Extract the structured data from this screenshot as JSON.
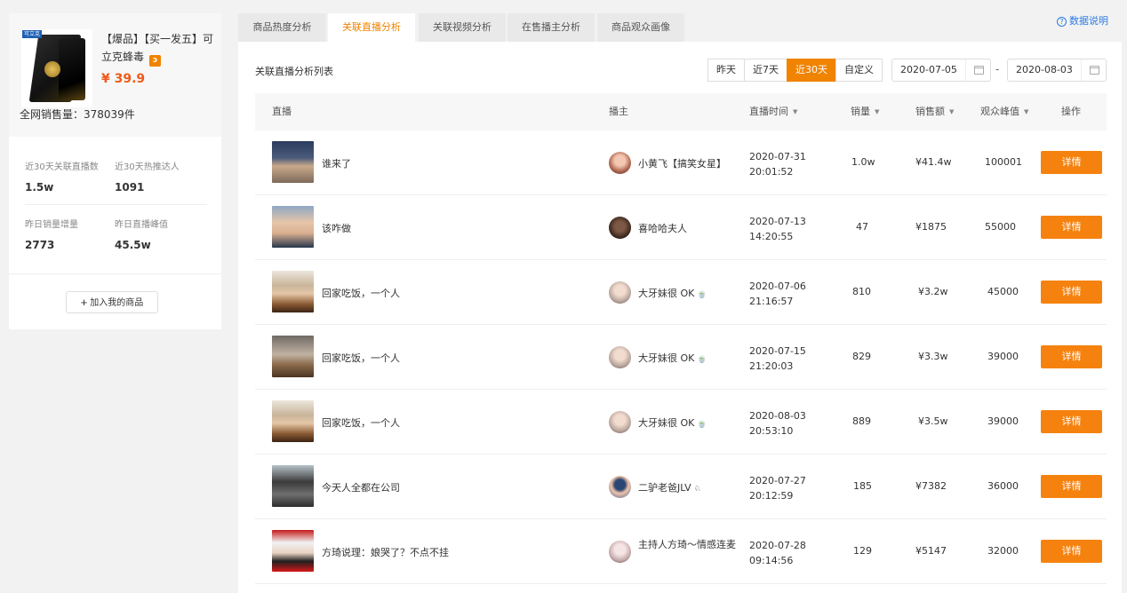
{
  "product": {
    "title": "【爆品】【买一发五】可立克蜂毒",
    "badge_icon": "rss-icon",
    "price": "¥ 39.9",
    "total_sales": "全网销售量：378039件",
    "image_tag": "可立克"
  },
  "stats": [
    {
      "label": "近30天关联直播数",
      "value": "1.5w"
    },
    {
      "label": "近30天热推达人",
      "value": "1091"
    },
    {
      "label": "昨日销量增量",
      "value": "2773"
    },
    {
      "label": "昨日直播峰值",
      "value": "45.5w"
    }
  ],
  "add_button": "加入我的商品",
  "tabs": [
    {
      "label": "商品热度分析",
      "active": false
    },
    {
      "label": "关联直播分析",
      "active": true
    },
    {
      "label": "关联视频分析",
      "active": false
    },
    {
      "label": "在售播主分析",
      "active": false
    },
    {
      "label": "商品观众画像",
      "active": false
    }
  ],
  "help_link": "数据说明",
  "list_title": "关联直播分析列表",
  "range_buttons": [
    {
      "label": "昨天",
      "active": false
    },
    {
      "label": "近7天",
      "active": false
    },
    {
      "label": "近30天",
      "active": true
    },
    {
      "label": "自定义",
      "active": false
    }
  ],
  "date_start": "2020-07-05",
  "date_end": "2020-08-03",
  "date_sep": "-",
  "columns": {
    "live": "直播",
    "anchor": "播主",
    "time": "直播时间",
    "sales": "销量",
    "amount": "销售额",
    "peak": "观众峰值",
    "action": "操作"
  },
  "sort_arrow": "▼",
  "rows": [
    {
      "title": "谁来了",
      "anchor": "小黄飞【搞笑女星】",
      "anchor_icon": "",
      "date": "2020-07-31",
      "clock": "20:01:52",
      "sales": "1.0w",
      "amount": "¥41.4w",
      "peak": "100001",
      "action": "详情"
    },
    {
      "title": "该咋做",
      "anchor": "喜哈哈夫人",
      "anchor_icon": "",
      "date": "2020-07-13",
      "clock": "14:20:55",
      "sales": "47",
      "amount": "¥1875",
      "peak": "55000",
      "action": "详情"
    },
    {
      "title": "回家吃饭，一个人",
      "anchor": "大牙妹很 OK",
      "anchor_icon": "🍵",
      "date": "2020-07-06",
      "clock": "21:16:57",
      "sales": "810",
      "amount": "¥3.2w",
      "peak": "45000",
      "action": "详情"
    },
    {
      "title": "回家吃饭，一个人",
      "anchor": "大牙妹很 OK",
      "anchor_icon": "🍵",
      "date": "2020-07-15",
      "clock": "21:20:03",
      "sales": "829",
      "amount": "¥3.3w",
      "peak": "39000",
      "action": "详情"
    },
    {
      "title": "回家吃饭，一个人",
      "anchor": "大牙妹很 OK",
      "anchor_icon": "🍵",
      "date": "2020-08-03",
      "clock": "20:53:10",
      "sales": "889",
      "amount": "¥3.5w",
      "peak": "39000",
      "action": "详情"
    },
    {
      "title": "今天人全都在公司",
      "anchor": "二驴老爸JLV",
      "anchor_icon": "♘",
      "date": "2020-07-27",
      "clock": "20:12:59",
      "sales": "185",
      "amount": "¥7382",
      "peak": "36000",
      "action": "详情"
    },
    {
      "title": "方琦说理：娘哭了？不点不挂",
      "anchor": "主持人方琦～情感连麦",
      "anchor_icon": "",
      "date": "2020-07-28",
      "clock": "09:14:56",
      "sales": "129",
      "amount": "¥5147",
      "peak": "32000",
      "action": "详情"
    }
  ],
  "colors": {
    "accent": "#f08300",
    "button": "#f5820f",
    "price": "#f05a1a",
    "link": "#2c7be5"
  }
}
